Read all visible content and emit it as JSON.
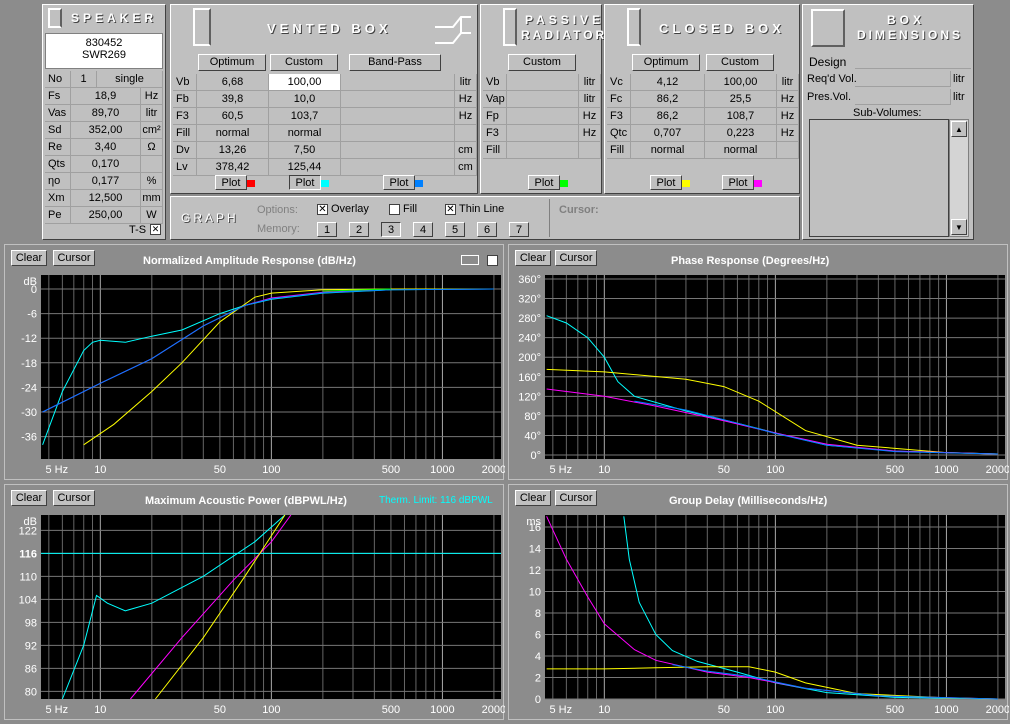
{
  "speaker": {
    "title": "SPEAKER",
    "model1": "830452",
    "model2": "SWR269",
    "rows": [
      {
        "label": "No",
        "value": "1",
        "unit": "single"
      },
      {
        "label": "Fs",
        "value": "18,9",
        "unit": "Hz"
      },
      {
        "label": "Vas",
        "value": "89,70",
        "unit": "litr"
      },
      {
        "label": "Sd",
        "value": "352,00",
        "unit": "cm²"
      },
      {
        "label": "Re",
        "value": "3,40",
        "unit": "Ω"
      },
      {
        "label": "Qts",
        "value": "0,170",
        "unit": ""
      },
      {
        "label": "ηo",
        "value": "0,177",
        "unit": "%"
      },
      {
        "label": "Xm",
        "value": "12,500",
        "unit": "mm"
      },
      {
        "label": "Pe",
        "value": "250,00",
        "unit": "W"
      }
    ],
    "ts_label": "T-S",
    "ts_check": "✕"
  },
  "vented": {
    "title": "VENTED BOX",
    "col_optimum": "Optimum",
    "col_custom": "Custom",
    "col_bandpass": "Band-Pass",
    "rows": [
      {
        "label": "Vb",
        "opt": "6,68",
        "cust": "100,00",
        "unit": "litr"
      },
      {
        "label": "Fb",
        "opt": "39,8",
        "cust": "10,0",
        "unit": "Hz"
      },
      {
        "label": "F3",
        "opt": "60,5",
        "cust": "103,7",
        "unit": "Hz"
      },
      {
        "label": "Fill",
        "opt": "normal",
        "cust": "normal",
        "unit": ""
      },
      {
        "label": "Dv",
        "opt": "13,26",
        "cust": "7,50",
        "unit": "cm"
      },
      {
        "label": "Lv",
        "opt": "378,42",
        "cust": "125,44",
        "unit": "cm"
      }
    ],
    "plot": "Plot"
  },
  "passive": {
    "title1": "PASSIVE",
    "title2": "RADIATOR",
    "col_custom": "Custom",
    "rows": [
      {
        "label": "Vb",
        "unit": "litr"
      },
      {
        "label": "Vap",
        "unit": "litr"
      },
      {
        "label": "Fp",
        "unit": "Hz"
      },
      {
        "label": "F3",
        "unit": "Hz"
      },
      {
        "label": "Fill",
        "unit": ""
      }
    ],
    "plot": "Plot"
  },
  "closed": {
    "title": "CLOSED BOX",
    "col_optimum": "Optimum",
    "col_custom": "Custom",
    "rows": [
      {
        "label": "Vc",
        "opt": "4,12",
        "cust": "100,00",
        "unit": "litr"
      },
      {
        "label": "Fc",
        "opt": "86,2",
        "cust": "25,5",
        "unit": "Hz"
      },
      {
        "label": "F3",
        "opt": "86,2",
        "cust": "108,7",
        "unit": "Hz"
      },
      {
        "label": "Qtc",
        "opt": "0,707",
        "cust": "0,223",
        "unit": "Hz"
      },
      {
        "label": "Fill",
        "opt": "normal",
        "cust": "normal",
        "unit": ""
      }
    ],
    "plot": "Plot"
  },
  "box": {
    "title1": "BOX",
    "title2": "DIMENSIONS",
    "design": "Design",
    "reqd": "Req'd Vol.",
    "pres": "Pres.Vol.",
    "unit": "litr",
    "sub": "Sub-Volumes:"
  },
  "graph": {
    "title": "GRAPH",
    "options": "Options:",
    "overlay": "Overlay",
    "fill": "Fill",
    "thin": "Thin Line",
    "cursor": "Cursor:",
    "memory": "Memory:",
    "mem": [
      "1",
      "2",
      "3",
      "4",
      "5",
      "6",
      "7"
    ],
    "check": "✕"
  },
  "colors": {
    "red": "#ff0000",
    "cyan": "#00ffff",
    "blue": "#0080ff",
    "green": "#00ff00",
    "yellow": "#ffff00",
    "magenta": "#ff00ff"
  },
  "graphs": {
    "clear": "Clear",
    "cursor": "Cursor",
    "amp": {
      "title": "Normalized Amplitude Response (dB/Hz)",
      "unit": "dB",
      "ylabels": [
        "0",
        "-6",
        "-12",
        "-18",
        "-24",
        "-30",
        "-36"
      ],
      "xlabels": [
        "5 Hz",
        "10",
        "50",
        "100",
        "500",
        "1000",
        "2000"
      ]
    },
    "phase": {
      "title": "Phase Response (Degrees/Hz)",
      "ylabels": [
        "360°",
        "320°",
        "280°",
        "240°",
        "200°",
        "160°",
        "120°",
        "80°",
        "40°",
        "0°"
      ],
      "xlabels": [
        "5 Hz",
        "10",
        "50",
        "100",
        "500",
        "1000",
        "2000"
      ]
    },
    "power": {
      "title": "Maximum Acoustic Power (dBPWL/Hz)",
      "therm": "Therm. Limit: 116 dBPWL",
      "unit": "dB",
      "ylabels": [
        "122",
        "116",
        "110",
        "104",
        "98",
        "92",
        "86",
        "80"
      ],
      "xlabels": [
        "5 Hz",
        "10",
        "50",
        "100",
        "500",
        "1000",
        "2000"
      ]
    },
    "delay": {
      "title": "Group Delay (Milliseconds/Hz)",
      "unit": "ms",
      "ylabels": [
        "16",
        "14",
        "12",
        "10",
        "8",
        "6",
        "4",
        "2",
        "0"
      ],
      "xlabels": [
        "5 Hz",
        "10",
        "50",
        "100",
        "500",
        "1000",
        "2000"
      ]
    }
  }
}
